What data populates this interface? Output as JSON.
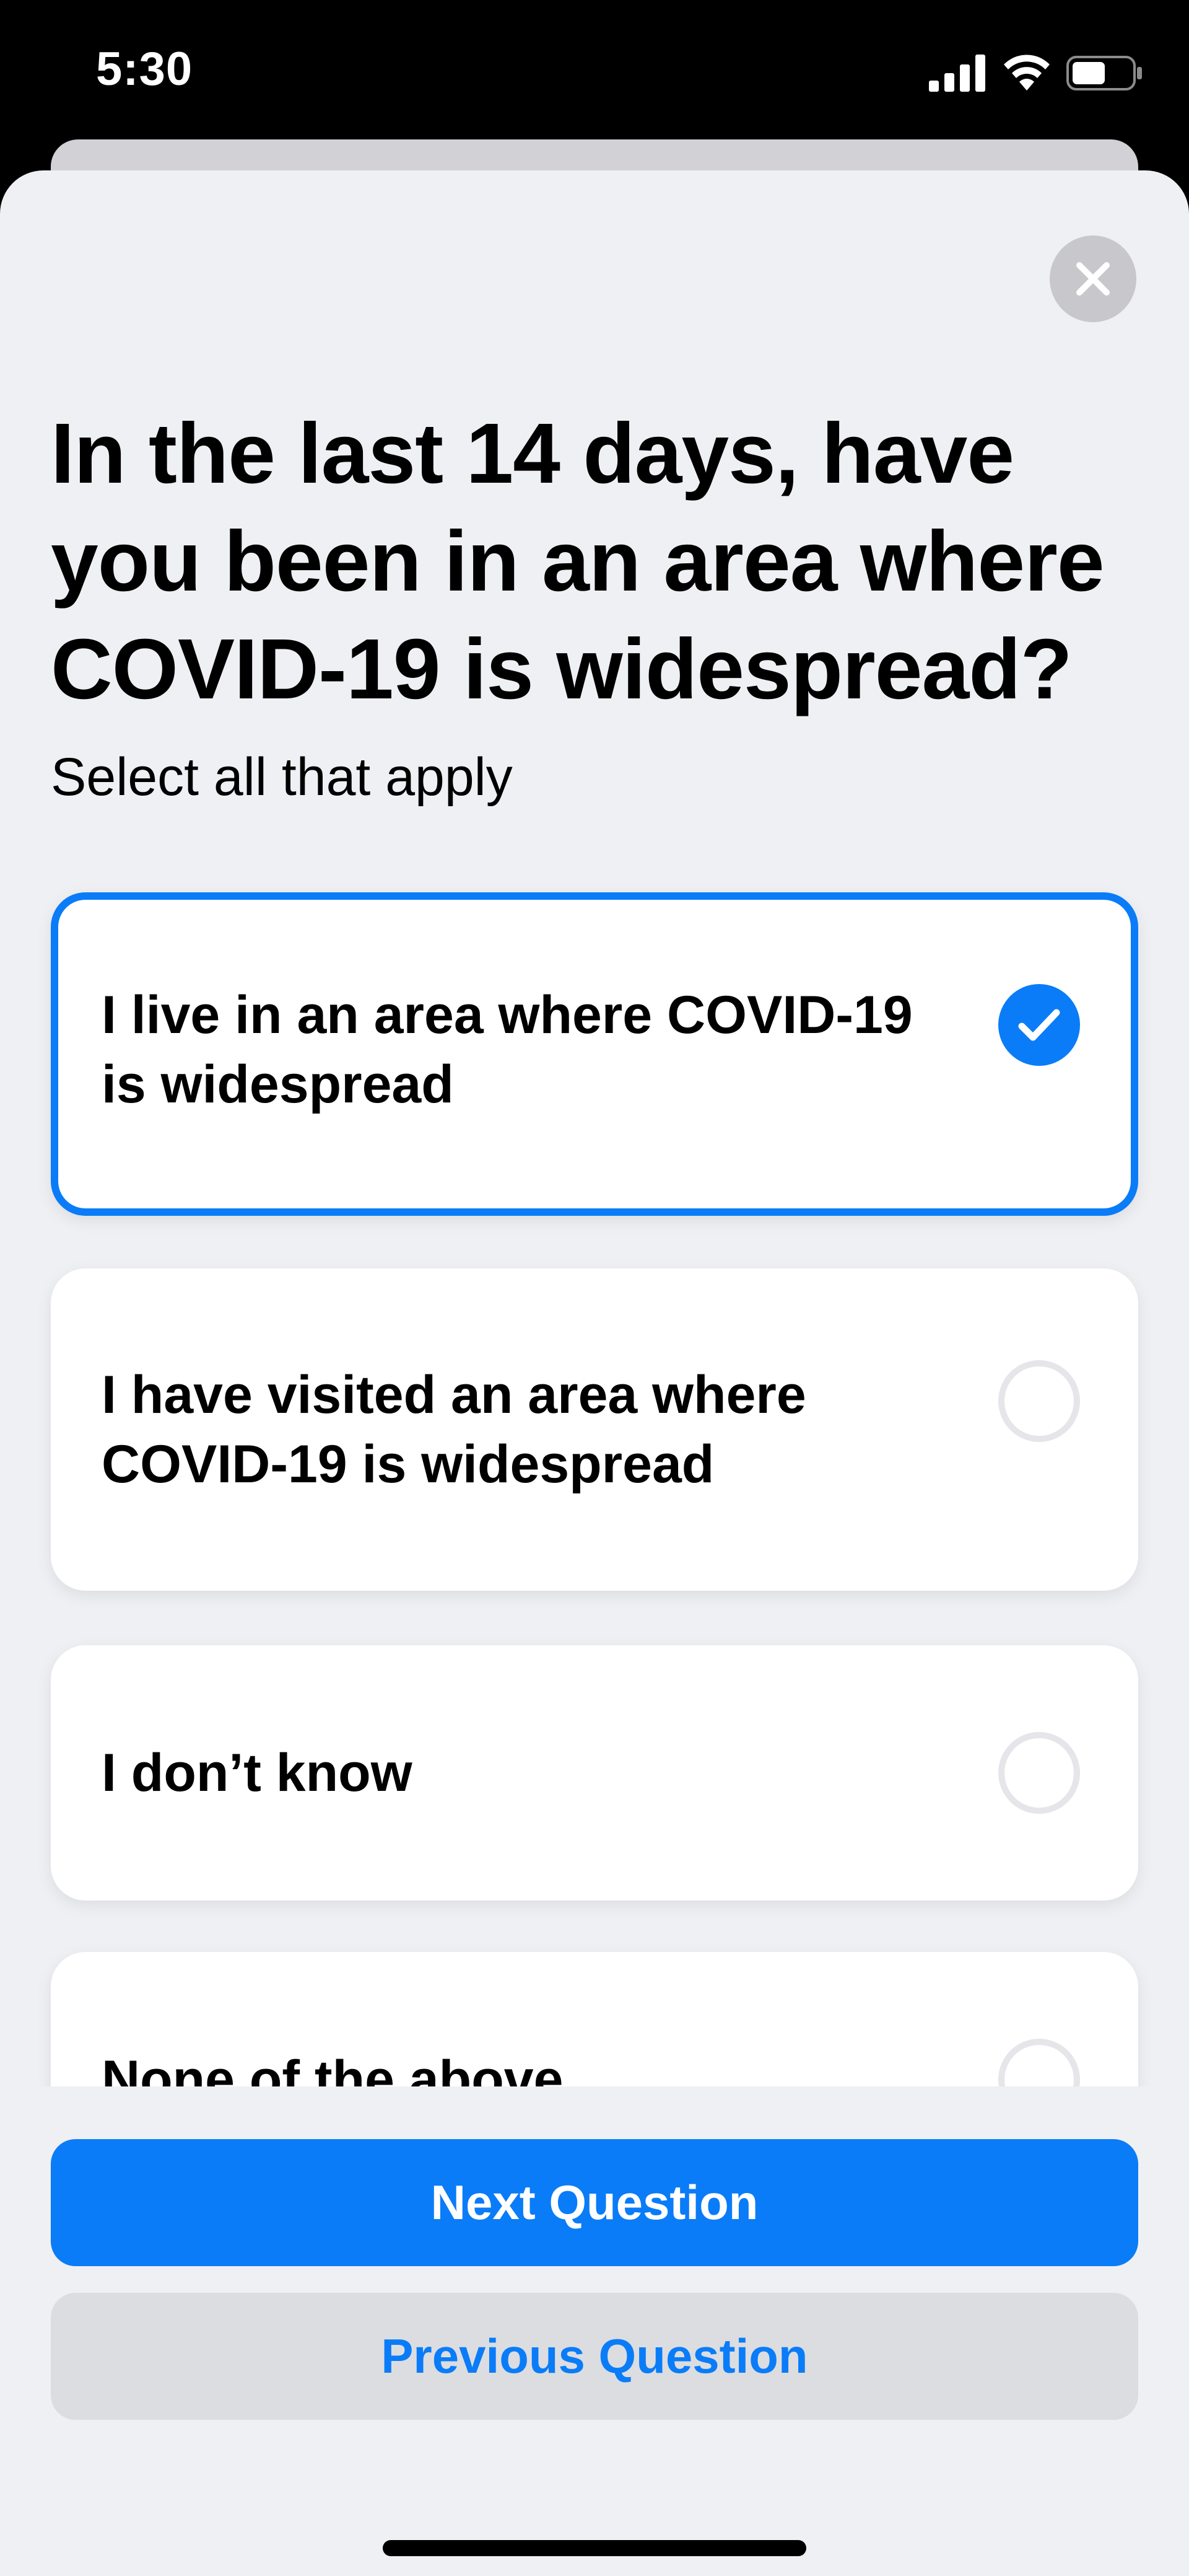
{
  "status_bar": {
    "time": "5:30",
    "signal_icon": "cellular-signal-icon",
    "wifi_icon": "wifi-icon",
    "battery_icon": "battery-icon"
  },
  "sheet": {
    "close_icon": "close-icon",
    "question": "In the last 14 days, have you been in an area where COVID-19 is widespread?",
    "instruction": "Select all that apply",
    "options": [
      {
        "label": "I live in an area where COVID-19 is widespread",
        "selected": true
      },
      {
        "label": "I have visited an area where COVID-19 is widespread",
        "selected": false
      },
      {
        "label": "I don’t know",
        "selected": false
      },
      {
        "label": "None of the above",
        "selected": false
      }
    ]
  },
  "footer": {
    "next_label": "Next Question",
    "previous_label": "Previous Question"
  },
  "colors": {
    "accent": "#0a7cf8",
    "sheet_background": "#eff0f3",
    "secondary_button": "#dcdde0"
  }
}
